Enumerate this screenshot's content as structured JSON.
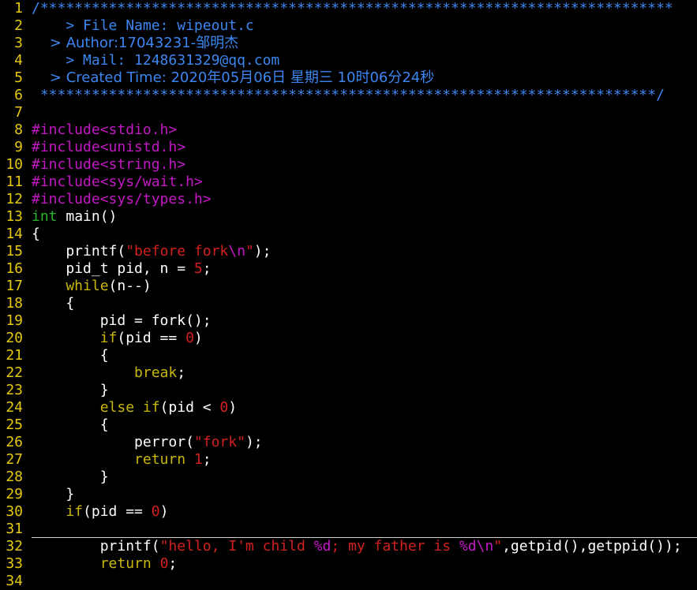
{
  "editor": {
    "file": "wipeout.c",
    "colors": {
      "background": "#000000",
      "line_number": "#e5c810",
      "comment": "#3d86f0",
      "preprocessor": "#c318c3",
      "type": "#2ab52a",
      "keyword": "#c8b80c",
      "string": "#d12020",
      "normal": "#ffffff",
      "brace_match": "#11c1b8",
      "cursor": "#19e61e"
    },
    "cursor_line": 31,
    "lines": [
      {
        "n": "1",
        "s": [
          {
            "c": "comment",
            "t": "/**************************************************************************"
          }
        ]
      },
      {
        "n": "2",
        "s": [
          {
            "c": "comment",
            "t": "    > File Name: wipeout.c"
          }
        ]
      },
      {
        "n": "3",
        "s": [
          {
            "c": "comment",
            "t": "    > Author:17043231-邹明杰"
          }
        ]
      },
      {
        "n": "4",
        "s": [
          {
            "c": "comment",
            "t": "    > Mail: 1248631329@qq.com"
          }
        ]
      },
      {
        "n": "5",
        "s": [
          {
            "c": "comment",
            "t": "    > Created Time: 2020年05月06日 星期三 10时06分24秒"
          }
        ]
      },
      {
        "n": "6",
        "s": [
          {
            "c": "comment",
            "t": " ************************************************************************/"
          }
        ]
      },
      {
        "n": "7",
        "s": []
      },
      {
        "n": "8",
        "s": [
          {
            "c": "pre",
            "t": "#include<stdio.h>"
          }
        ]
      },
      {
        "n": "9",
        "s": [
          {
            "c": "pre",
            "t": "#include<unistd.h>"
          }
        ]
      },
      {
        "n": "10",
        "s": [
          {
            "c": "pre",
            "t": "#include<string.h>"
          }
        ]
      },
      {
        "n": "11",
        "s": [
          {
            "c": "pre",
            "t": "#include<sys/wait.h>"
          }
        ]
      },
      {
        "n": "12",
        "s": [
          {
            "c": "pre",
            "t": "#include<sys/types.h>"
          }
        ]
      },
      {
        "n": "13",
        "s": [
          {
            "c": "type",
            "t": "int"
          },
          {
            "c": "norm",
            "t": " main()"
          }
        ]
      },
      {
        "n": "14",
        "s": [
          {
            "c": "norm",
            "t": "{"
          }
        ]
      },
      {
        "n": "15",
        "s": [
          {
            "c": "norm",
            "t": "    printf("
          },
          {
            "c": "str",
            "t": "\"before fork"
          },
          {
            "c": "esc",
            "t": "\\n"
          },
          {
            "c": "str",
            "t": "\""
          },
          {
            "c": "norm",
            "t": ");"
          }
        ]
      },
      {
        "n": "16",
        "s": [
          {
            "c": "norm",
            "t": "    pid_t pid, n = "
          },
          {
            "c": "num",
            "t": "5"
          },
          {
            "c": "norm",
            "t": ";"
          }
        ]
      },
      {
        "n": "17",
        "s": [
          {
            "c": "kw",
            "t": "    while"
          },
          {
            "c": "norm",
            "t": "(n--)"
          }
        ]
      },
      {
        "n": "18",
        "s": [
          {
            "c": "norm",
            "t": "    {"
          }
        ]
      },
      {
        "n": "19",
        "s": [
          {
            "c": "norm",
            "t": "        pid = fork();"
          }
        ]
      },
      {
        "n": "20",
        "s": [
          {
            "c": "kw",
            "t": "        if"
          },
          {
            "c": "norm",
            "t": "(pid == "
          },
          {
            "c": "num",
            "t": "0"
          },
          {
            "c": "norm",
            "t": ")"
          }
        ]
      },
      {
        "n": "21",
        "s": [
          {
            "c": "norm",
            "t": "        {"
          }
        ]
      },
      {
        "n": "22",
        "s": [
          {
            "c": "kw",
            "t": "            break"
          },
          {
            "c": "norm",
            "t": ";"
          }
        ]
      },
      {
        "n": "23",
        "s": [
          {
            "c": "norm",
            "t": "        }"
          }
        ]
      },
      {
        "n": "24",
        "s": [
          {
            "c": "kw",
            "t": "        else if"
          },
          {
            "c": "norm",
            "t": "(pid < "
          },
          {
            "c": "num",
            "t": "0"
          },
          {
            "c": "norm",
            "t": ")"
          }
        ]
      },
      {
        "n": "25",
        "s": [
          {
            "c": "norm",
            "t": "        {"
          }
        ]
      },
      {
        "n": "26",
        "s": [
          {
            "c": "norm",
            "t": "            perror("
          },
          {
            "c": "str",
            "t": "\"fork\""
          },
          {
            "c": "norm",
            "t": ");"
          }
        ]
      },
      {
        "n": "27",
        "s": [
          {
            "c": "kw",
            "t": "            return"
          },
          {
            "c": "norm",
            "t": " "
          },
          {
            "c": "num",
            "t": "1"
          },
          {
            "c": "norm",
            "t": ";"
          }
        ]
      },
      {
        "n": "28",
        "s": [
          {
            "c": "norm",
            "t": "        }"
          }
        ]
      },
      {
        "n": "29",
        "s": [
          {
            "c": "norm",
            "t": "    }"
          }
        ]
      },
      {
        "n": "30",
        "s": [
          {
            "c": "kw",
            "t": "    if"
          },
          {
            "c": "norm",
            "t": "(pid == "
          },
          {
            "c": "num",
            "t": "0"
          },
          {
            "c": "norm",
            "t": ")"
          }
        ]
      },
      {
        "n": "31",
        "s": [
          {
            "c": "norm",
            "t": "    "
          },
          {
            "c": "bracematch",
            "t": "{"
          },
          {
            "c": "cursor",
            "t": " "
          }
        ]
      },
      {
        "n": "32",
        "s": [
          {
            "c": "norm",
            "t": "        printf("
          },
          {
            "c": "str",
            "t": "\"hello, I'm child "
          },
          {
            "c": "esc",
            "t": "%d"
          },
          {
            "c": "str",
            "t": "; my father is "
          },
          {
            "c": "esc",
            "t": "%d\\n"
          },
          {
            "c": "str",
            "t": "\""
          },
          {
            "c": "norm",
            "t": ",getpid(),getppid());"
          }
        ]
      },
      {
        "n": "33",
        "s": [
          {
            "c": "kw",
            "t": "        return"
          },
          {
            "c": "norm",
            "t": " "
          },
          {
            "c": "num",
            "t": "0"
          },
          {
            "c": "norm",
            "t": ";"
          }
        ]
      },
      {
        "n": "34",
        "s": [
          {
            "c": "norm",
            "t": "    "
          },
          {
            "c": "bracematch",
            "t": "}"
          }
        ]
      }
    ]
  }
}
